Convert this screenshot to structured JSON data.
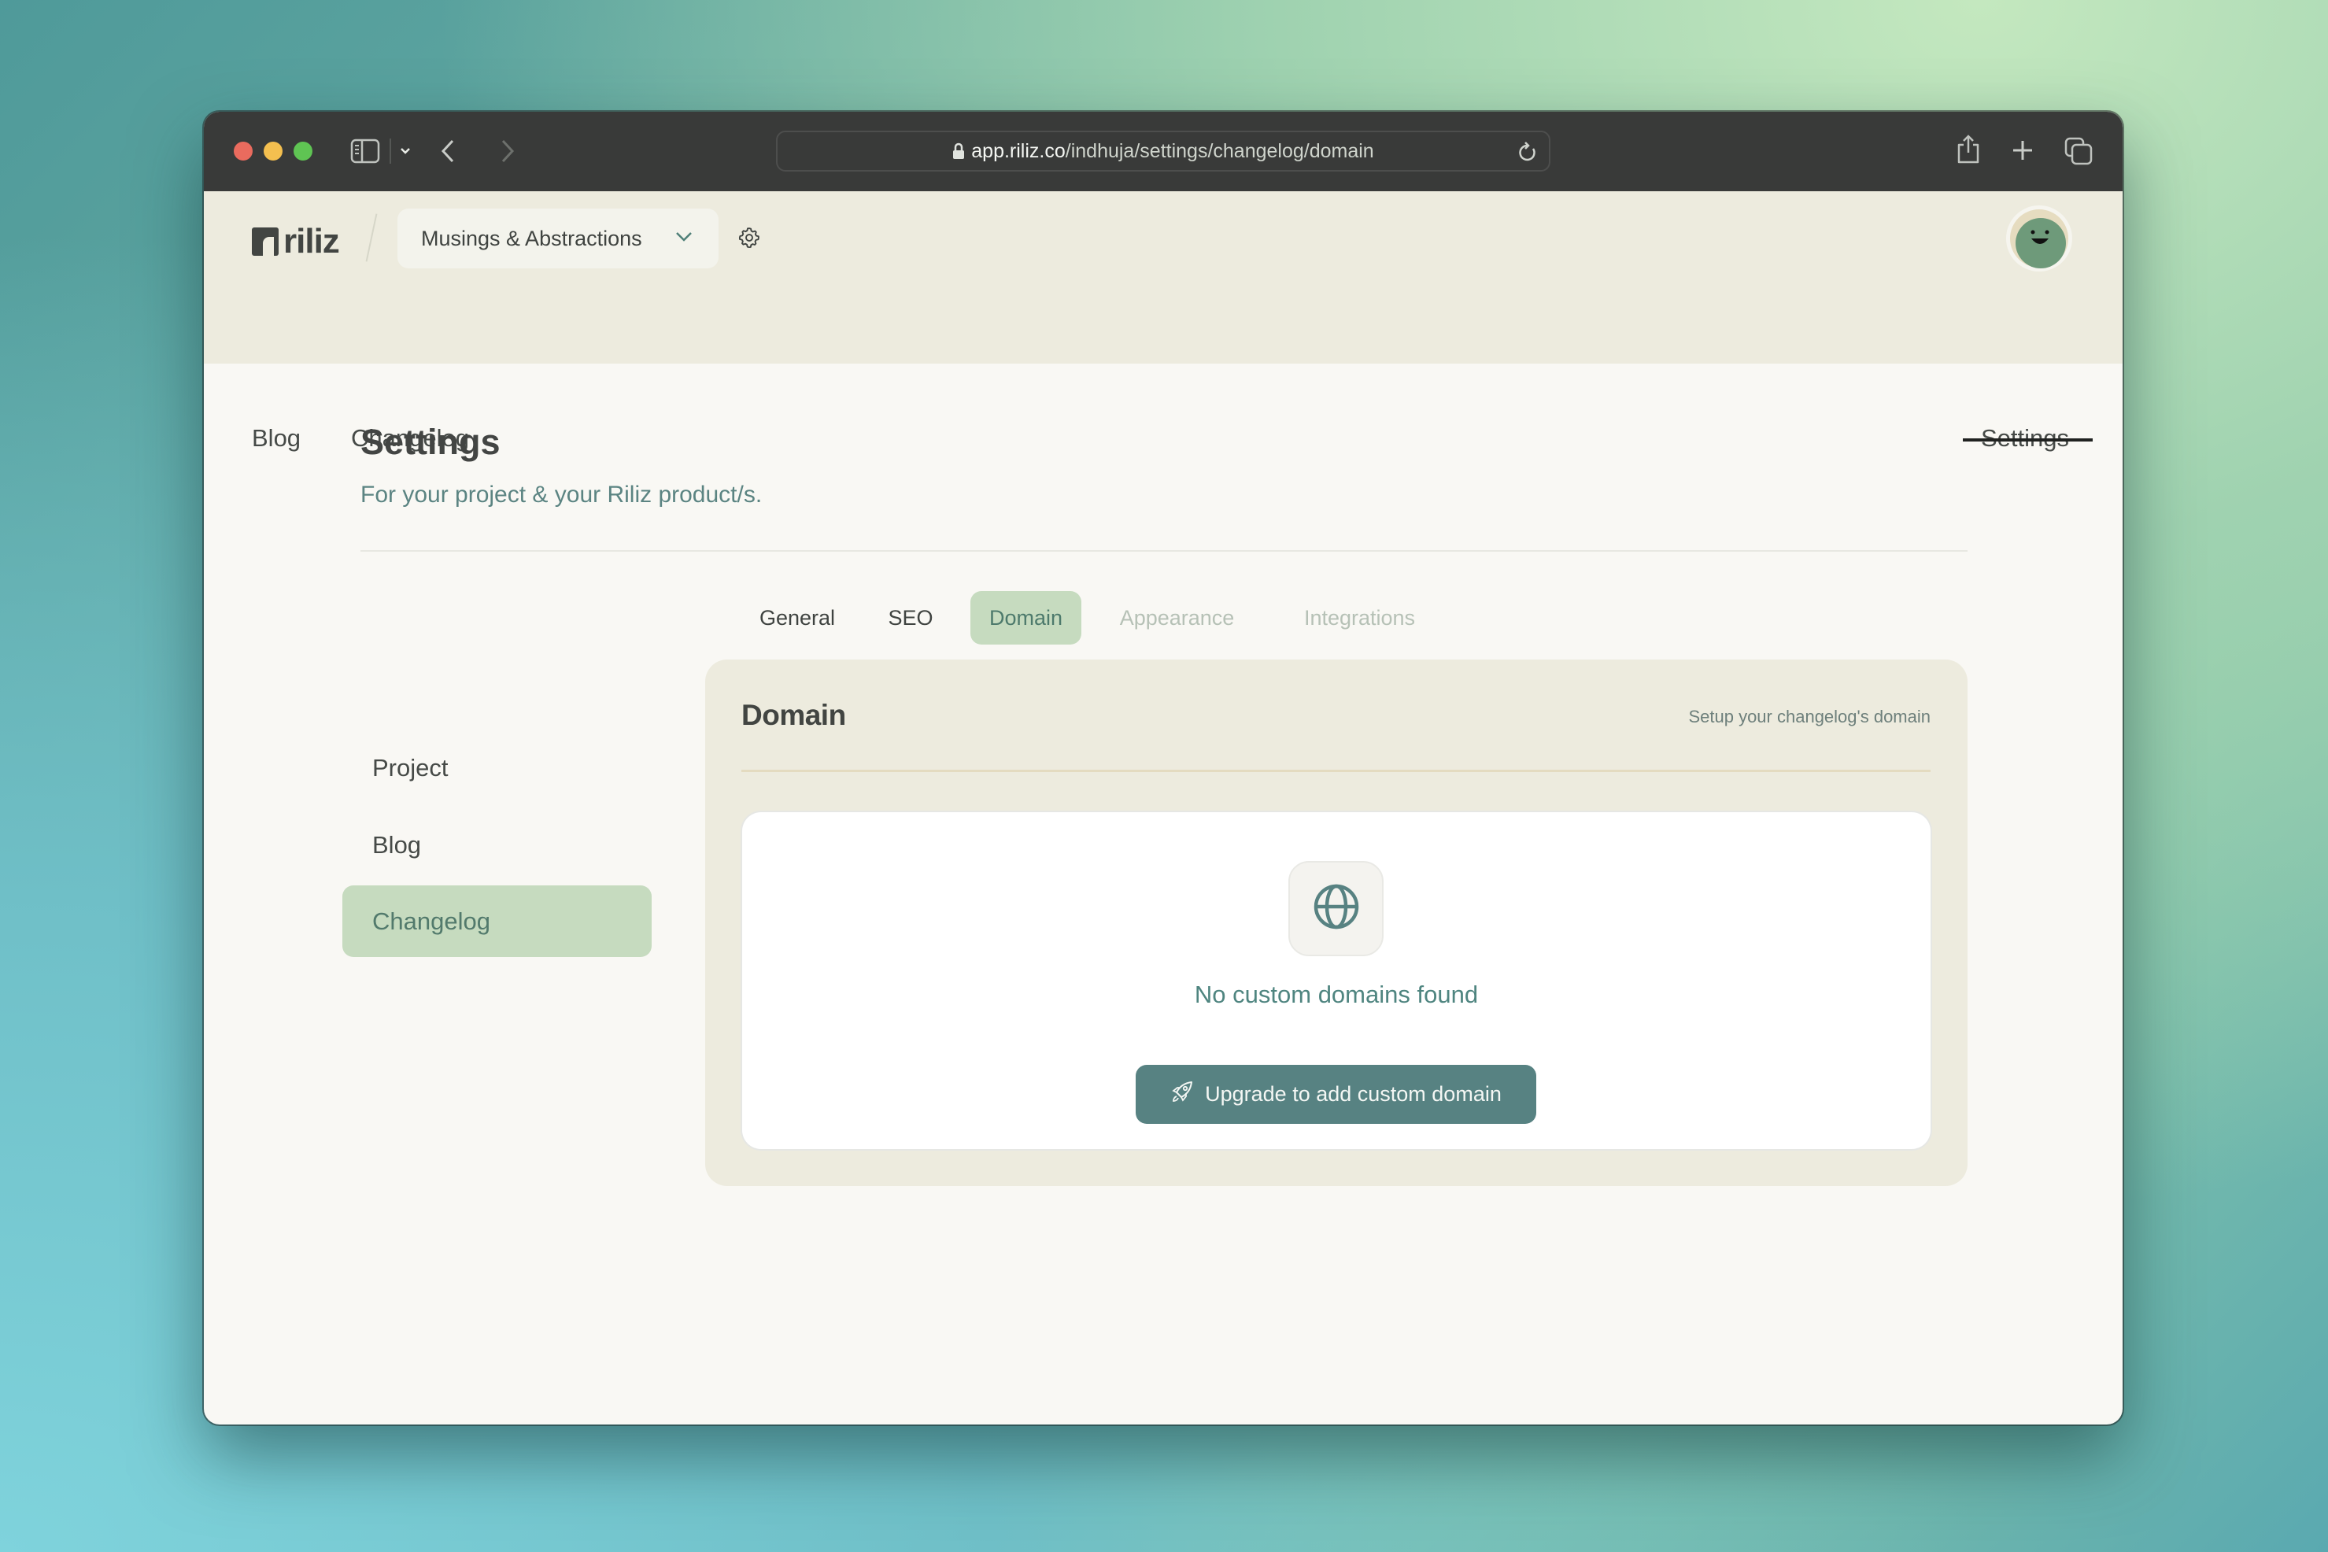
{
  "browser": {
    "url_host": "app.riliz.co",
    "url_path": "/indhuja/settings/changelog/domain",
    "icons": [
      "sidebar-toggle-icon",
      "chevron-down-icon",
      "back-icon",
      "forward-icon",
      "lock-icon",
      "reload-icon",
      "share-icon",
      "new-tab-icon",
      "tabs-overview-icon"
    ]
  },
  "header": {
    "logo_text": "riliz",
    "project_name": "Musings & Abstractions",
    "nav": [
      {
        "label": "Blog"
      },
      {
        "label": "Changelog"
      }
    ],
    "settings_label": "Settings"
  },
  "page": {
    "title": "Settings",
    "subtitle": "For your project & your Riliz product/s."
  },
  "sidebar": {
    "items": [
      {
        "label": "Project",
        "active": false
      },
      {
        "label": "Blog",
        "active": false
      },
      {
        "label": "Changelog",
        "active": true
      }
    ]
  },
  "tabs": [
    {
      "label": "General",
      "state": "enabled"
    },
    {
      "label": "SEO",
      "state": "enabled"
    },
    {
      "label": "Domain",
      "state": "active"
    },
    {
      "label": "Appearance",
      "state": "disabled"
    },
    {
      "label": "Integrations",
      "state": "disabled"
    }
  ],
  "domain_card": {
    "title": "Domain",
    "description": "Setup your changelog's domain",
    "empty_message": "No custom domains found",
    "upgrade_button": "Upgrade to add custom domain"
  },
  "colors": {
    "accent": "#578282",
    "active_bg": "#c6dbbf",
    "header_bg": "#edebde",
    "page_bg": "#f9f8f4",
    "toolbar_bg": "#393a39"
  }
}
